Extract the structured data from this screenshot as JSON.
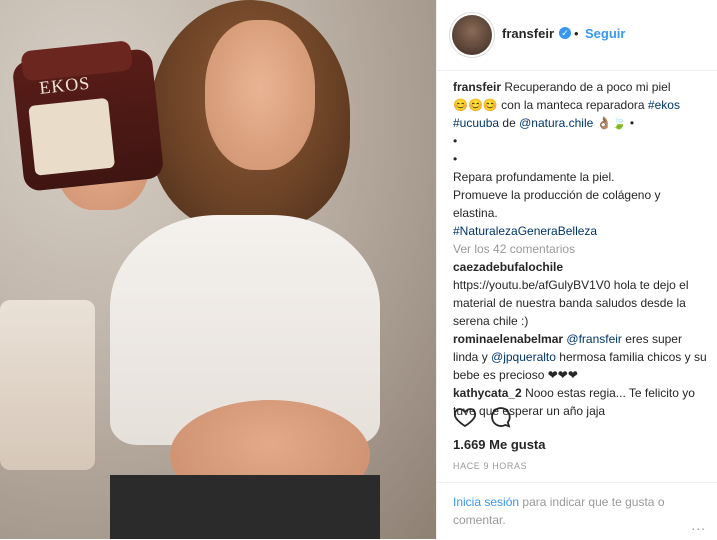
{
  "post": {
    "username": "fransfeir",
    "follow_label": "Seguir",
    "caption": {
      "user": "fransfeir",
      "lines": [
        "Recuperando de a poco mi piel",
        "😊😊😊 con la manteca reparadora",
        "#ekos",
        "#ucuuba",
        "de",
        "@natura.chile",
        "👌🏽🍃 •",
        "•",
        "•",
        "Repara profundamente la piel.",
        "Promueve la producción de colágeno y elastina.",
        "#NaturalezaGeneraBelleza"
      ]
    },
    "view_all": "Ver los 42 comentarios",
    "comments": [
      {
        "user": "caezadebufalochile",
        "text": "https://youtu.be/afGulyBV1V0 hola te dejo el material de nuestra banda saludos desde la serena chile :)"
      },
      {
        "user": "rominaelenabelmar",
        "mention1": "@fransfeir",
        "text1": "eres super linda y",
        "mention2": "@jpqueralto",
        "text2": "hermosa familia chicos y su bebe es precioso ❤❤❤"
      },
      {
        "user": "kathycata_2",
        "text": "Nooo estas regia... Te felicito yo tuve que esperar un año jaja"
      }
    ],
    "likes": "1.669 Me gusta",
    "time": "HACE 9 HORAS",
    "login_link": "Inicia sesión",
    "login_text": "para indicar que te gusta o comentar.",
    "more": "...",
    "photo_brand": "EKOS"
  },
  "icons": {
    "heart": "heart-outline",
    "comment": "comment-bubble",
    "verified": "verified-badge"
  },
  "colors": {
    "link": "#003569",
    "accent": "#3897f0",
    "muted": "#999999"
  }
}
